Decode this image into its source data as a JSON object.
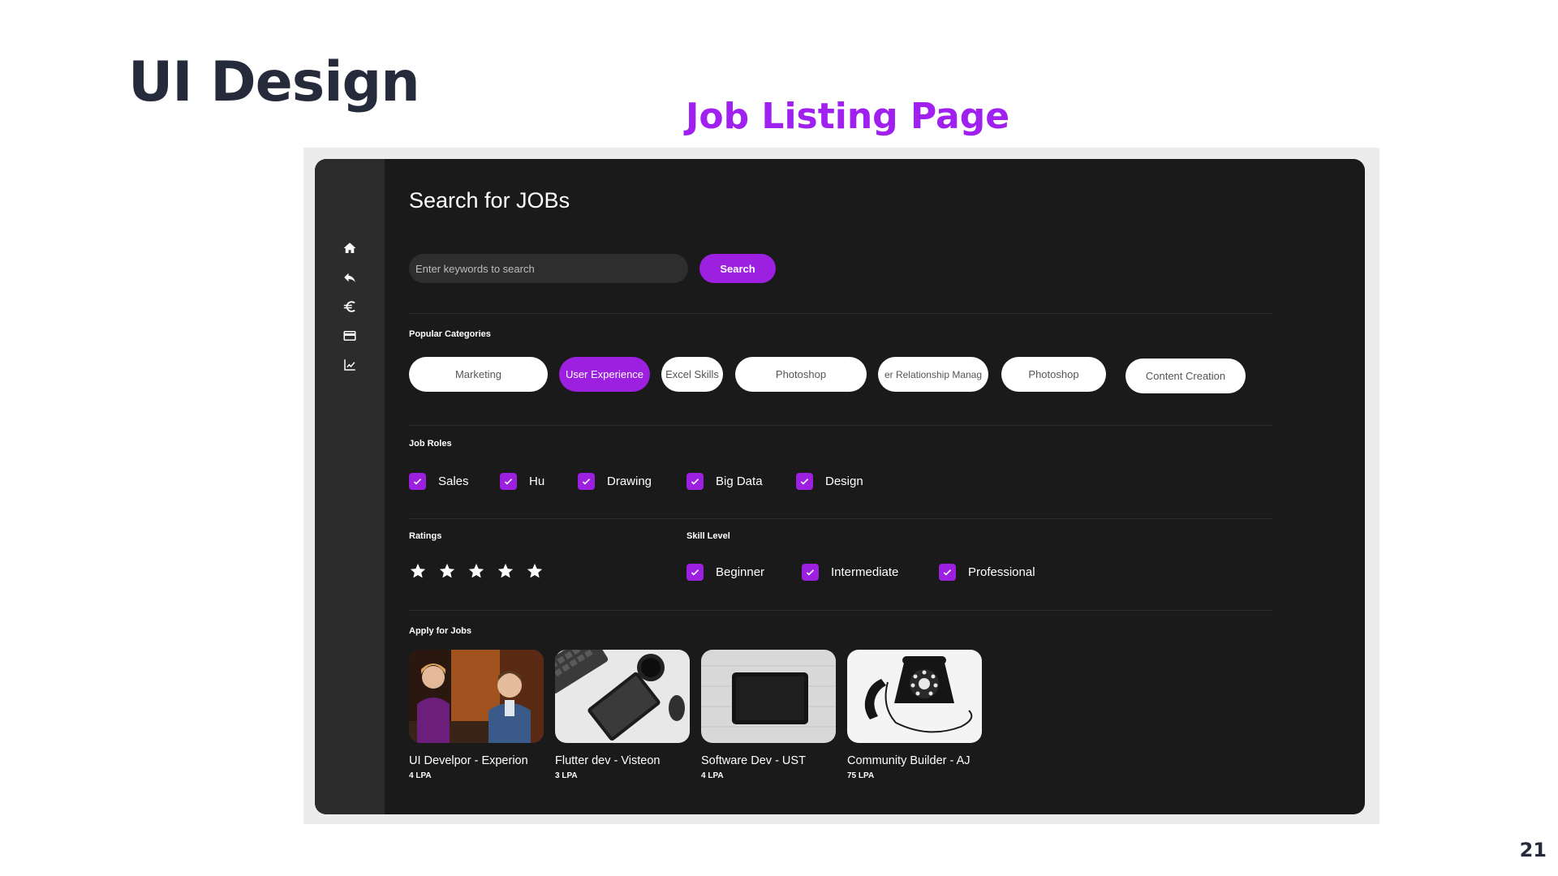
{
  "slide": {
    "title": "UI Design",
    "subtitle": "Job Listing Page",
    "page_number": "21"
  },
  "sidebar": {
    "items": [
      {
        "icon": "home-icon"
      },
      {
        "icon": "reply-icon"
      },
      {
        "icon": "euro-icon"
      },
      {
        "icon": "credit-card-icon"
      },
      {
        "icon": "chart-line-icon"
      }
    ]
  },
  "page": {
    "heading": "Search for JOBs"
  },
  "search": {
    "placeholder": "Enter keywords to search",
    "value": "",
    "button_label": "Search"
  },
  "popular_categories": {
    "label": "Popular Categories",
    "items": [
      {
        "label": "Marketing",
        "active": false
      },
      {
        "label": "User Experience",
        "active": true
      },
      {
        "label": "Excel Skills",
        "active": false
      },
      {
        "label": "Photoshop",
        "active": false
      },
      {
        "label": "er Relationship Manag",
        "active": false
      },
      {
        "label": "Photoshop",
        "active": false
      },
      {
        "label": "Content Creation",
        "active": false
      }
    ]
  },
  "job_roles": {
    "label": "Job Roles",
    "items": [
      {
        "label": "Sales",
        "checked": true
      },
      {
        "label": "Hu",
        "checked": true
      },
      {
        "label": "Drawing",
        "checked": true
      },
      {
        "label": "Big Data",
        "checked": true
      },
      {
        "label": "Design",
        "checked": true
      }
    ]
  },
  "ratings": {
    "label": "Ratings",
    "value": 5,
    "max": 5
  },
  "skill_level": {
    "label": "Skill Level",
    "items": [
      {
        "label": "Beginner",
        "checked": true
      },
      {
        "label": "Intermediate",
        "checked": true
      },
      {
        "label": "Professional",
        "checked": true
      }
    ]
  },
  "apply": {
    "label": "Apply for Jobs",
    "jobs": [
      {
        "title": "UI Develpor - Experion",
        "salary": "4 LPA",
        "image": "office-meeting-photo"
      },
      {
        "title": "Flutter dev - Visteon",
        "salary": "3 LPA",
        "image": "desk-tablet-keyboard-photo"
      },
      {
        "title": "Software Dev - UST",
        "salary": "4 LPA",
        "image": "tablet-on-desk-photo"
      },
      {
        "title": "Community Builder - AJ",
        "salary": "75 LPA",
        "image": "rotary-telephone-photo"
      }
    ]
  },
  "colors": {
    "accent": "#9d1fe0",
    "title_purple": "#a020f0",
    "app_bg": "#1a1a1a",
    "sidebar_bg": "#2c2c2c",
    "slide_title": "#262b3b"
  }
}
